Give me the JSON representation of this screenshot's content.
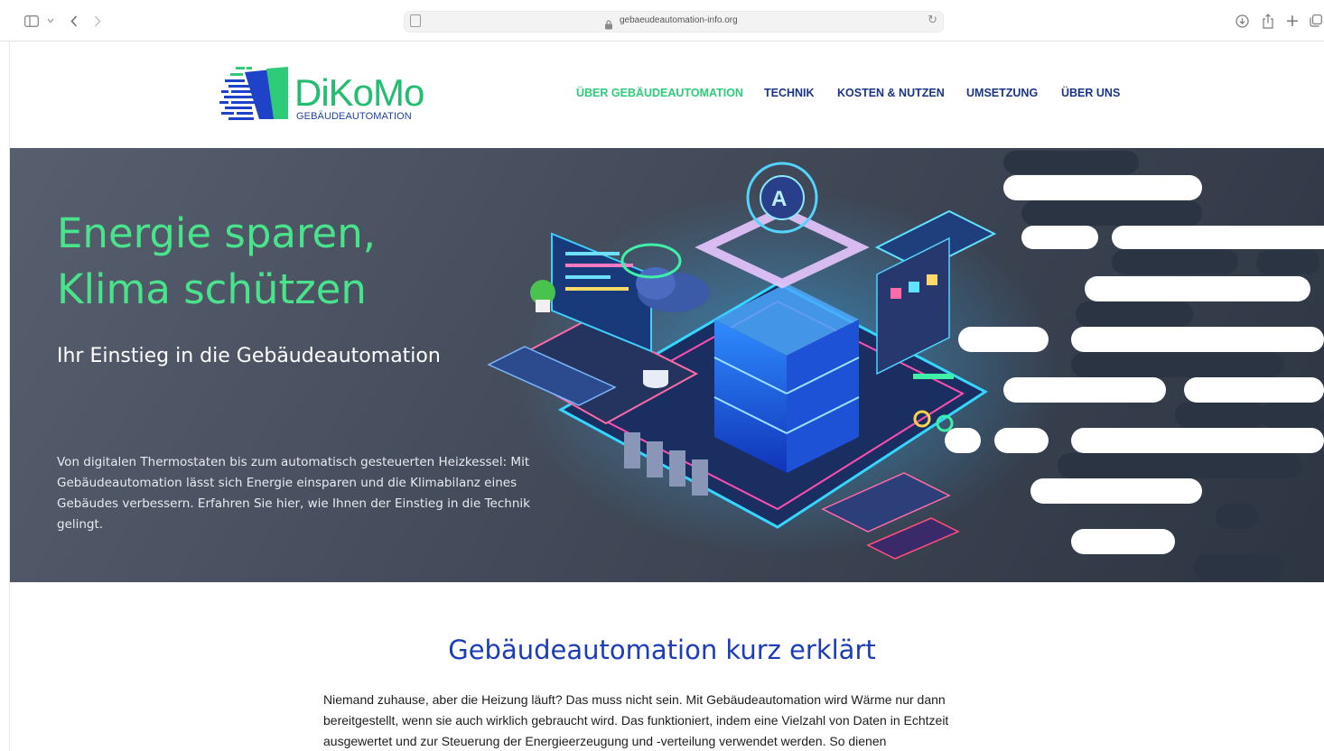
{
  "browser": {
    "url": "gebaeudeautomation-info.org",
    "icons": [
      "sidebar-icon",
      "chevron-down-icon",
      "back-icon",
      "forward-icon",
      "reader-icon",
      "lock-icon",
      "reload-icon",
      "download-icon",
      "share-icon",
      "new-tab-icon",
      "tabs-overview-icon"
    ]
  },
  "site": {
    "logo": {
      "name": "DiKoMo",
      "subtitle": "GEBÄUDEAUTOMATION"
    },
    "nav": [
      {
        "label": "ÜBER GEBÄUDEAUTOMATION",
        "active": true
      },
      {
        "label": "TECHNIK",
        "active": false
      },
      {
        "label": "KOSTEN & NUTZEN",
        "active": false
      },
      {
        "label": "UMSETZUNG",
        "active": false
      },
      {
        "label": "ÜBER UNS",
        "active": false
      }
    ]
  },
  "hero": {
    "title": "Energie sparen,\nKlima schützen",
    "subtitle": "Ihr Einstieg in die Gebäudeautomation",
    "text": "Von digitalen Thermostaten bis zum automatisch gesteuerten Heizkessel: Mit Gebäudeautomation lässt sich Energie einsparen und die Klimabilanz eines Gebäudes verbessern. Erfahren Sie hier, wie Ihnen der Einstieg in die Technik gelingt."
  },
  "section": {
    "heading": "Gebäudeautomation kurz erklärt",
    "text": "Niemand zuhause, aber die Heizung läuft? Das muss nicht sein. Mit Gebäudeautomation wird Wärme nur dann bereitgestellt, wenn sie auch wirklich gebraucht wird. Das funktioniert, indem eine Vielzahl von Daten in Echtzeit ausgewertet und zur Steuerung der Energieerzeugung und -verteilung verwendet werden. So dienen"
  },
  "colors": {
    "accent_green": "#2ecb78",
    "nav_blue": "#1a3586",
    "heading_blue": "#1c3db6",
    "hero_bg": "#434b5a"
  }
}
